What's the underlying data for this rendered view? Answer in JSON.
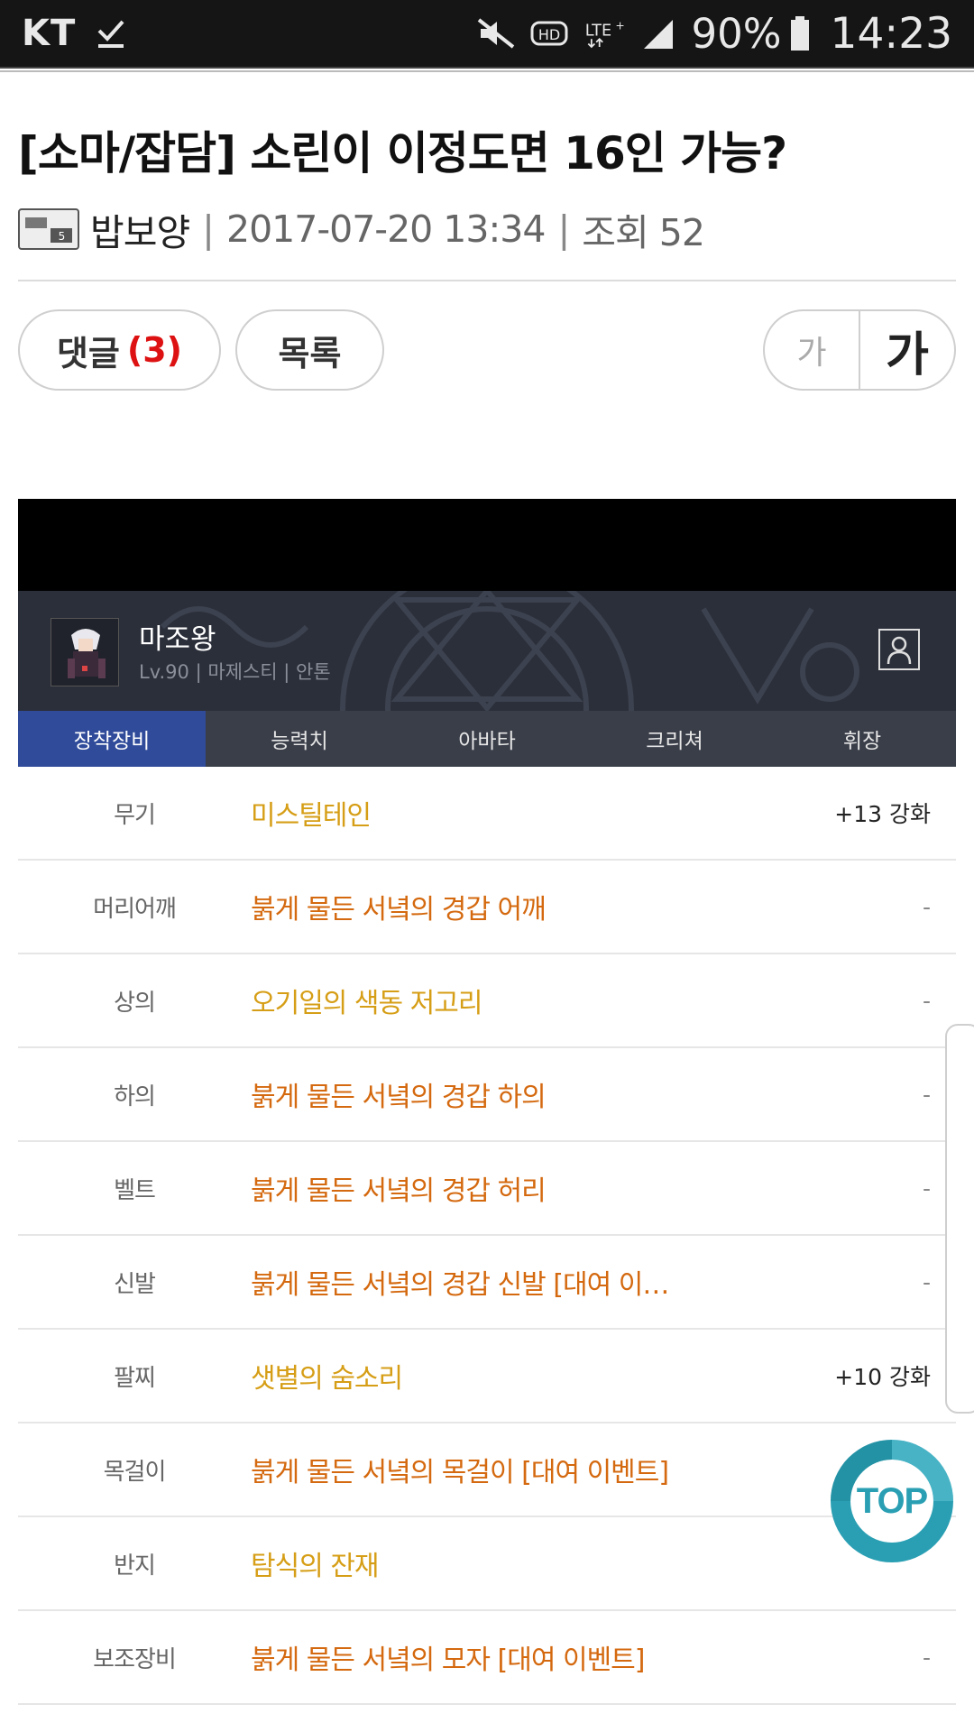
{
  "statusbar": {
    "carrier": "KT",
    "battery": "90%",
    "time": "14:23",
    "icons": [
      "download-check-icon",
      "mute-icon",
      "hd-icon",
      "lte-icon",
      "signal-icon",
      "battery-icon"
    ]
  },
  "article": {
    "title": "[소마/잡담] 소린이 이정도면 16인 가능?",
    "author": "밥보양",
    "date": "2017-07-20 13:34",
    "views": "조회 52",
    "separator": "|"
  },
  "buttons": {
    "comment_label": "댓글",
    "comment_count": "(3)",
    "list_label": "목록",
    "font_small": "가",
    "font_large": "가"
  },
  "character": {
    "name": "마조왕",
    "info": "Lv.90 | 마제스티 | 안톤"
  },
  "tabs": [
    "장착장비",
    "능력치",
    "아바타",
    "크리쳐",
    "휘장"
  ],
  "equipment": [
    {
      "slot": "무기",
      "item": "미스틸테인",
      "enhance": "+13 강화"
    },
    {
      "slot": "머리어깨",
      "item": "붉게 물든 서녘의 경갑 어깨",
      "enhance": "-"
    },
    {
      "slot": "상의",
      "item": "오기일의 색동 저고리",
      "enhance": "-"
    },
    {
      "slot": "하의",
      "item": "붉게 물든 서녘의 경갑 하의",
      "enhance": "-"
    },
    {
      "slot": "벨트",
      "item": "붉게 물든 서녘의 경갑 허리",
      "enhance": "-"
    },
    {
      "slot": "신발",
      "item": "붉게 물든 서녘의 경갑 신발 [대여 이…",
      "enhance": "-"
    },
    {
      "slot": "팔찌",
      "item": "샛별의 숨소리",
      "enhance": "+10 강화"
    },
    {
      "slot": "목걸이",
      "item": "붉게 물든 서녘의 목걸이 [대여 이벤트]",
      "enhance": ""
    },
    {
      "slot": "반지",
      "item": "탐식의 잔재",
      "enhance": ""
    },
    {
      "slot": "보조장비",
      "item": "붉게 물든 서녘의 모자 [대여 이벤트]",
      "enhance": "-"
    }
  ],
  "top_button": "TOP",
  "colors": {
    "item_orange": "#d4690f",
    "item_gold": "#d69e16",
    "tab_active": "#2f4b9a",
    "comment_count": "#dd1111",
    "top_teal": "#2a9fb3"
  }
}
